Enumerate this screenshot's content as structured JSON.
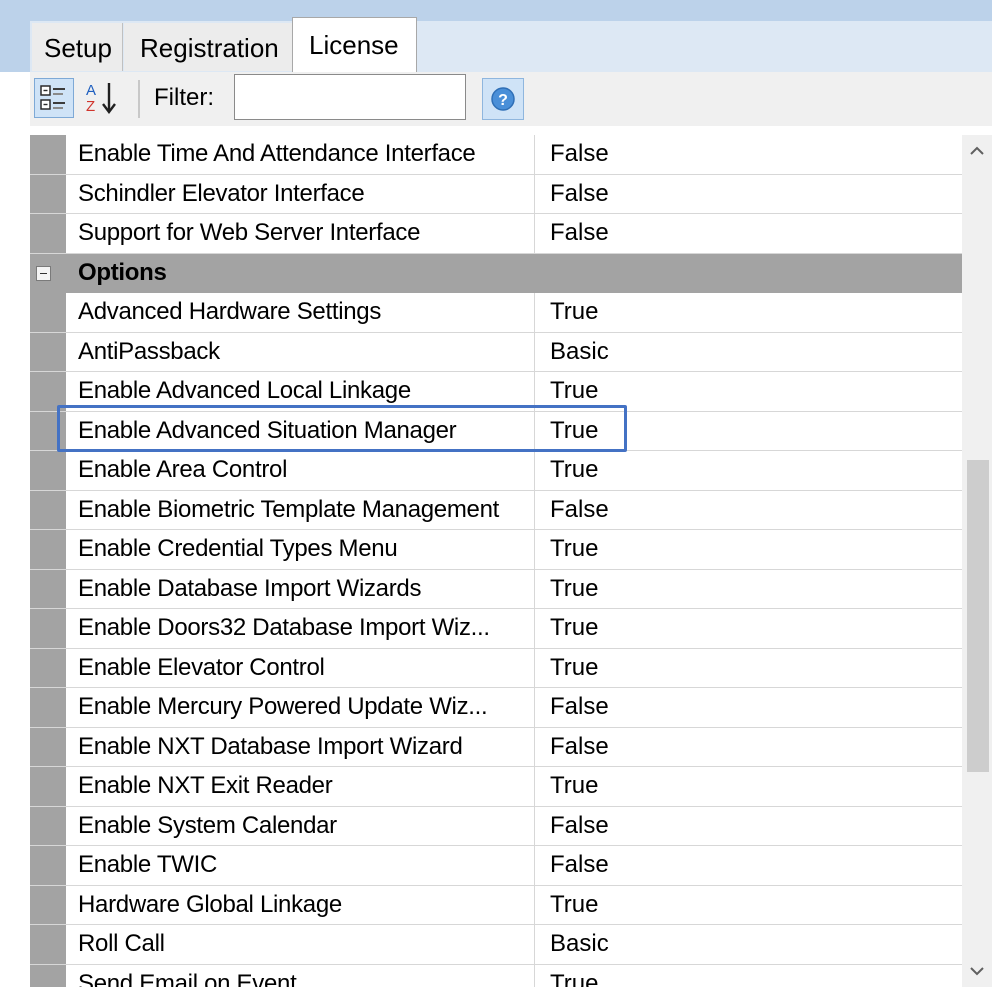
{
  "tabs": [
    {
      "label": "Setup",
      "active": false
    },
    {
      "label": "Registration",
      "active": false
    },
    {
      "label": "License",
      "active": true
    }
  ],
  "toolbar": {
    "filter_label": "Filter:",
    "filter_value": "",
    "categorized_icon": "categorized-view-icon",
    "alphabetical_icon": "sort-alphabetical-icon",
    "help_icon": "help-icon"
  },
  "grid": {
    "rows": [
      {
        "name": "Enable Time And Attendance Interface",
        "value": "False"
      },
      {
        "name": "Schindler Elevator Interface",
        "value": "False"
      },
      {
        "name": "Support for Web Server Interface",
        "value": "False"
      },
      {
        "name": "Options",
        "value": "",
        "category": true
      },
      {
        "name": "Advanced Hardware Settings",
        "value": "True"
      },
      {
        "name": "AntiPassback",
        "value": "Basic"
      },
      {
        "name": "Enable Advanced Local Linkage",
        "value": "True"
      },
      {
        "name": "Enable Advanced Situation Manager",
        "value": "True",
        "highlighted": true
      },
      {
        "name": "Enable Area Control",
        "value": "True"
      },
      {
        "name": "Enable Biometric Template Management",
        "value": "False"
      },
      {
        "name": "Enable Credential Types Menu",
        "value": "True"
      },
      {
        "name": "Enable Database Import Wizards",
        "value": "True"
      },
      {
        "name": "Enable Doors32 Database Import Wiz...",
        "value": "True"
      },
      {
        "name": "Enable Elevator Control",
        "value": "True"
      },
      {
        "name": "Enable Mercury Powered Update Wiz...",
        "value": "False"
      },
      {
        "name": "Enable NXT Database Import Wizard",
        "value": "False"
      },
      {
        "name": "Enable NXT Exit Reader",
        "value": "True"
      },
      {
        "name": "Enable System Calendar",
        "value": "False"
      },
      {
        "name": "Enable TWIC",
        "value": "False"
      },
      {
        "name": "Hardware Global Linkage",
        "value": "True"
      },
      {
        "name": "Roll Call",
        "value": "Basic"
      },
      {
        "name": "Send Email on Event",
        "value": "True"
      }
    ]
  },
  "scrollbar": {
    "up_glyph": "^",
    "down_glyph": "v"
  },
  "colors": {
    "tab_strip": "#bcd2ea",
    "category_row": "#a3a3a3",
    "highlight_border": "#4472c4"
  }
}
